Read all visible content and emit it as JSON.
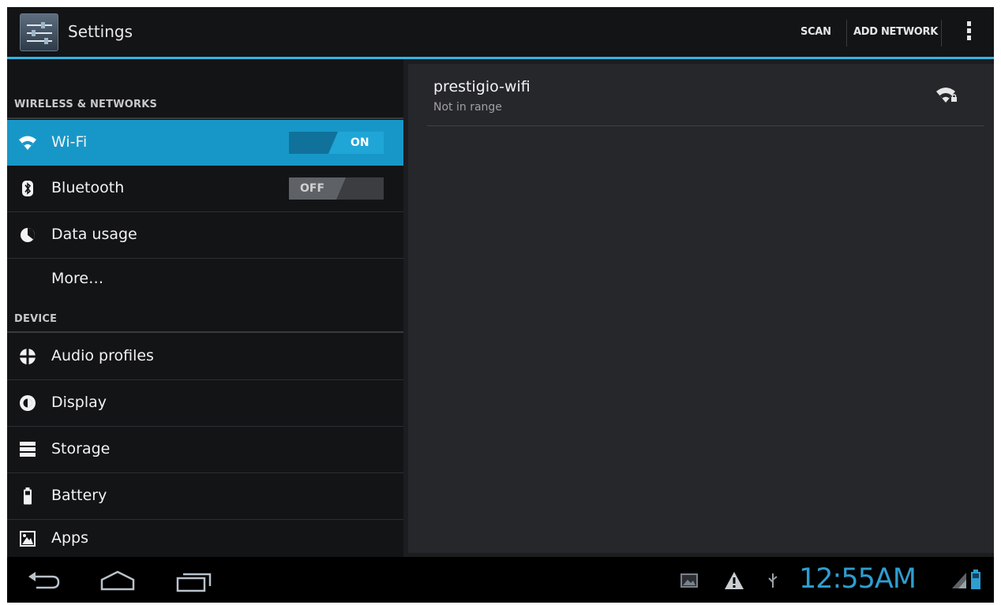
{
  "actionbar": {
    "title": "Settings",
    "scan_label": "SCAN",
    "add_network_label": "ADD NETWORK",
    "app_icon": "settings-sliders-icon",
    "overflow_icon": "overflow-menu-icon"
  },
  "sidebar": {
    "wireless_header": "WIRELESS & NETWORKS",
    "device_header": "DEVICE",
    "items": [
      {
        "label": "Wi-Fi",
        "icon": "wifi-icon",
        "toggle": "ON",
        "active": true
      },
      {
        "label": "Bluetooth",
        "icon": "bluetooth-icon",
        "toggle": "OFF"
      },
      {
        "label": "Data usage",
        "icon": "data-usage-icon"
      },
      {
        "label": "More…",
        "icon": ""
      },
      {
        "label": "Audio profiles",
        "icon": "audio-profiles-icon"
      },
      {
        "label": "Display",
        "icon": "display-icon"
      },
      {
        "label": "Storage",
        "icon": "storage-icon"
      },
      {
        "label": "Battery",
        "icon": "battery-icon"
      },
      {
        "label": "Apps",
        "icon": "apps-icon"
      }
    ]
  },
  "network": {
    "name": "prestigio-wifi",
    "status": "Not in range",
    "icon": "wifi-signal-locked-icon"
  },
  "systembar": {
    "time": "12:55AM",
    "icons": [
      "back-icon",
      "home-icon",
      "recent-apps-icon",
      "gallery-notification-icon",
      "warning-icon",
      "usb-icon",
      "signal-icon",
      "battery-status-icon"
    ]
  },
  "colors": {
    "accent": "#33b5e5",
    "active_item": "#1797c8",
    "clock": "#2f9dd0"
  }
}
